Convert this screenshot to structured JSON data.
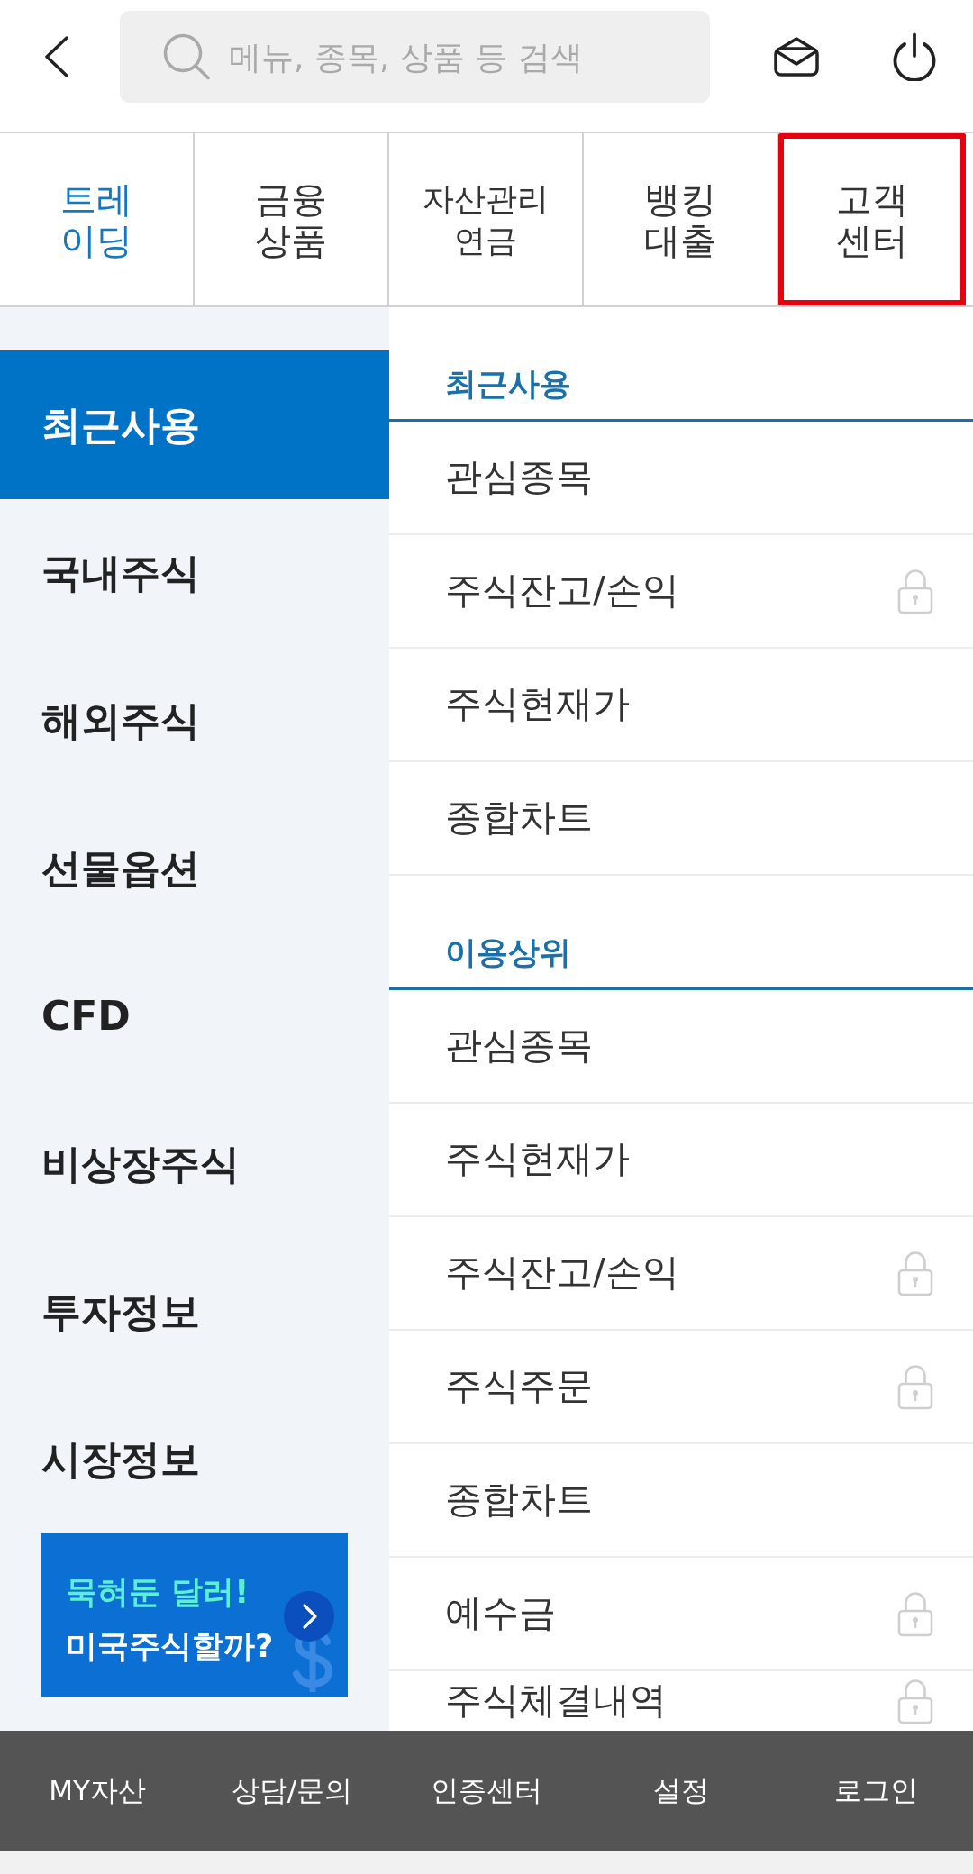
{
  "header": {
    "search": {
      "placeholder": "메뉴, 종목, 상품 등 검색"
    }
  },
  "tabs": [
    {
      "lines": [
        "트레",
        "이딩"
      ],
      "selected": true,
      "highlighted": false
    },
    {
      "lines": [
        "금융",
        "상품"
      ],
      "selected": false,
      "highlighted": false
    },
    {
      "lines": [
        "자산관리",
        "연금"
      ],
      "selected": false,
      "highlighted": false
    },
    {
      "lines": [
        "뱅킹",
        "대출"
      ],
      "selected": false,
      "highlighted": false
    },
    {
      "lines": [
        "고객",
        "센터"
      ],
      "selected": false,
      "highlighted": true
    }
  ],
  "sidebar": {
    "items": [
      {
        "label": "최근사용",
        "selected": true
      },
      {
        "label": "국내주식",
        "selected": false
      },
      {
        "label": "해외주식",
        "selected": false
      },
      {
        "label": "선물옵션",
        "selected": false
      },
      {
        "label": "CFD",
        "selected": false
      },
      {
        "label": "비상장주식",
        "selected": false
      },
      {
        "label": "투자정보",
        "selected": false
      },
      {
        "label": "시장정보",
        "selected": false
      }
    ],
    "banner": {
      "headline": "묵혀둔 달러!",
      "subline": "미국주식할까?"
    }
  },
  "sections": [
    {
      "title": "최근사용",
      "items": [
        {
          "label": "관심종목",
          "locked": false
        },
        {
          "label": "주식잔고/손익",
          "locked": true
        },
        {
          "label": "주식현재가",
          "locked": false
        },
        {
          "label": "종합차트",
          "locked": false
        }
      ]
    },
    {
      "title": "이용상위",
      "items": [
        {
          "label": "관심종목",
          "locked": false
        },
        {
          "label": "주식현재가",
          "locked": false
        },
        {
          "label": "주식잔고/손익",
          "locked": true
        },
        {
          "label": "주식주문",
          "locked": true
        },
        {
          "label": "종합차트",
          "locked": false
        },
        {
          "label": "예수금",
          "locked": true
        },
        {
          "label": "주식체결내역",
          "locked": true
        }
      ]
    }
  ],
  "bottom_nav": {
    "items": [
      "MY자산",
      "상담/문의",
      "인증센터",
      "설정",
      "로그인"
    ]
  }
}
